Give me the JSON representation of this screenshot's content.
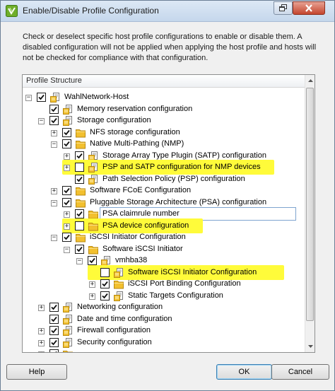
{
  "window": {
    "title": "Enable/Disable Profile Configuration",
    "description": "Check or deselect specific host profile configurations to enable or disable them. A disabled configuration will not be applied when applying the host profile and hosts will not be checked for compliance with that configuration."
  },
  "tree": {
    "header": "Profile Structure",
    "items": [
      {
        "label": "WahlNetwork-Host",
        "expander": "−",
        "checked": true,
        "icon": "profile-icon",
        "highlighted": false
      },
      {
        "label": "Memory reservation configuration",
        "expander": "",
        "checked": true,
        "icon": "profile-icon",
        "highlighted": false
      },
      {
        "label": "Storage configuration",
        "expander": "−",
        "checked": true,
        "icon": "profile-icon",
        "highlighted": false
      },
      {
        "label": "NFS storage configuration",
        "expander": "+",
        "checked": true,
        "icon": "folder-icon",
        "highlighted": false
      },
      {
        "label": "Native Multi-Pathing (NMP)",
        "expander": "−",
        "checked": true,
        "icon": "folder-icon",
        "highlighted": false
      },
      {
        "label": "Storage Array Type Plugin (SATP) configuration",
        "expander": "+",
        "checked": true,
        "icon": "profile-icon",
        "highlighted": false
      },
      {
        "label": "PSP and SATP configuration for NMP devices",
        "expander": "+",
        "checked": false,
        "icon": "profile-icon",
        "highlighted": true
      },
      {
        "label": "Path Selection Policy (PSP) configuration",
        "expander": "",
        "checked": true,
        "icon": "profile-icon",
        "highlighted": false
      },
      {
        "label": "Software FCoE Configuration",
        "expander": "+",
        "checked": true,
        "icon": "folder-icon",
        "highlighted": false
      },
      {
        "label": "Pluggable Storage Architecture (PSA) configuration",
        "expander": "−",
        "checked": true,
        "icon": "folder-icon",
        "highlighted": false
      },
      {
        "label": "PSA claimrule number",
        "expander": "+",
        "checked": true,
        "icon": "folder-icon",
        "highlighted": false
      },
      {
        "label": "PSA device configuration",
        "expander": "+",
        "checked": false,
        "icon": "folder-icon",
        "highlighted": true
      },
      {
        "label": "iSCSI Initiator Configuration",
        "expander": "−",
        "checked": true,
        "icon": "folder-icon",
        "highlighted": false
      },
      {
        "label": "Software iSCSI Initiator",
        "expander": "−",
        "checked": true,
        "icon": "folder-icon",
        "highlighted": false
      },
      {
        "label": "vmhba38",
        "expander": "−",
        "checked": true,
        "icon": "profile-icon",
        "highlighted": false
      },
      {
        "label": "Software iSCSI Initiator Configuration",
        "expander": "",
        "checked": false,
        "icon": "profile-icon",
        "highlighted": true
      },
      {
        "label": "iSCSI Port Binding Configuration",
        "expander": "+",
        "checked": true,
        "icon": "folder-icon",
        "highlighted": false
      },
      {
        "label": "Static Targets Configuration",
        "expander": "+",
        "checked": true,
        "icon": "profile-icon",
        "highlighted": false
      },
      {
        "label": "Networking configuration",
        "expander": "+",
        "checked": true,
        "icon": "profile-icon",
        "highlighted": false
      },
      {
        "label": "Date and time configuration",
        "expander": "",
        "checked": true,
        "icon": "profile-icon",
        "highlighted": false
      },
      {
        "label": "Firewall configuration",
        "expander": "+",
        "checked": true,
        "icon": "profile-icon",
        "highlighted": false
      },
      {
        "label": "Security configuration",
        "expander": "+",
        "checked": true,
        "icon": "profile-icon",
        "highlighted": false
      },
      {
        "label": "",
        "expander": "+",
        "checked": true,
        "icon": "folder-icon",
        "highlighted": false
      }
    ]
  },
  "buttons": {
    "help": "Help",
    "ok": "OK",
    "cancel": "Cancel"
  },
  "colors": {
    "highlight": "#fffb3a",
    "titlebar": "#c5d7ec",
    "close": "#c4452e",
    "folder": "#f2c02f"
  }
}
